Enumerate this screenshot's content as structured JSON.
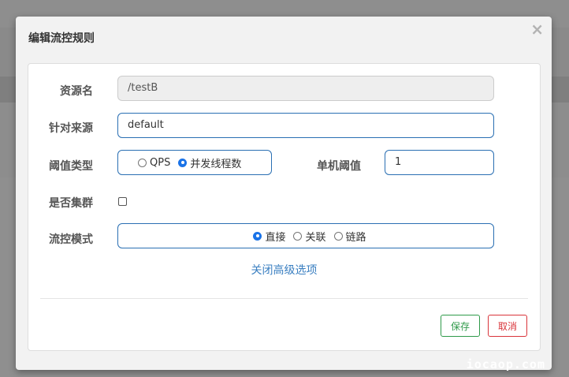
{
  "dialog": {
    "title": "编辑流控规则",
    "close_symbol": "×"
  },
  "form": {
    "resource": {
      "label": "资源名",
      "value": "/testB"
    },
    "source": {
      "label": "针对来源",
      "value": "default"
    },
    "threshold_type": {
      "label": "阈值类型",
      "options": [
        "QPS",
        "并发线程数"
      ],
      "selected": "并发线程数"
    },
    "single_threshold": {
      "label": "单机阈值",
      "value": "1"
    },
    "cluster": {
      "label": "是否集群",
      "checked": false
    },
    "flow_mode": {
      "label": "流控模式",
      "options": [
        "直接",
        "关联",
        "链路"
      ],
      "selected": "直接"
    },
    "advanced_toggle": "关闭高级选项"
  },
  "footer": {
    "save_label": "保存",
    "cancel_label": "取消"
  },
  "watermark": "iocaop.com",
  "colors": {
    "accent_border": "#2a6fb3",
    "link": "#3a7fc1",
    "save": "#2f9a4a",
    "cancel": "#d9343a"
  }
}
